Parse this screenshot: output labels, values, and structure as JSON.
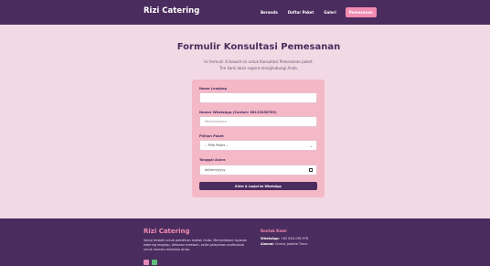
{
  "navbar": {
    "brand": "Rizi Catering",
    "links": [
      "Beranda",
      "Daftar Paket",
      "Galeri",
      "Pemesanan"
    ],
    "active_color": "#f18bb0",
    "bg_color": "#4b2c5e"
  },
  "hero": {
    "title": "Formulir Konsultasi Pemesanan",
    "subtitle_line1": "Isi formulir di bawah ini untuk Konsultasi Pemesanan paket.",
    "subtitle_line2": "Tim kami akan segera menghubungi Anda."
  },
  "form": {
    "name_label": "Nama Lengkap",
    "name_value": "",
    "whatsapp_label": "Nomor WhatsApp (Contoh: 08123456789)",
    "whatsapp_placeholder": "08xxxxxxxxx",
    "package_label": "Pilihan Paket",
    "package_selected": "-- Pilih Paket --",
    "date_label": "Tanggal Acara",
    "date_placeholder": "dd/mm/yyyy",
    "submit_label": "Kirim & Lanjut ke WhatsApp",
    "card_color": "#f4b8c7"
  },
  "footer": {
    "brand": "Rizi Catering",
    "description": "Solusi terbaik untuk pemilihan makan Anda. Menyediakan layanan katering lengkap, dekorasi meewah, serta pelayanan profesional untuk momen istimewa Anda.",
    "contact_title": "Kontak Kami",
    "whatsapp_label": "WhatsApp:",
    "whatsapp_value": "+62 818-198-976",
    "address_label": "Alamat:",
    "address_value": "Cinere, Jakarta Timur",
    "icons": [
      "instagram-icon",
      "whatsapp-icon"
    ]
  }
}
